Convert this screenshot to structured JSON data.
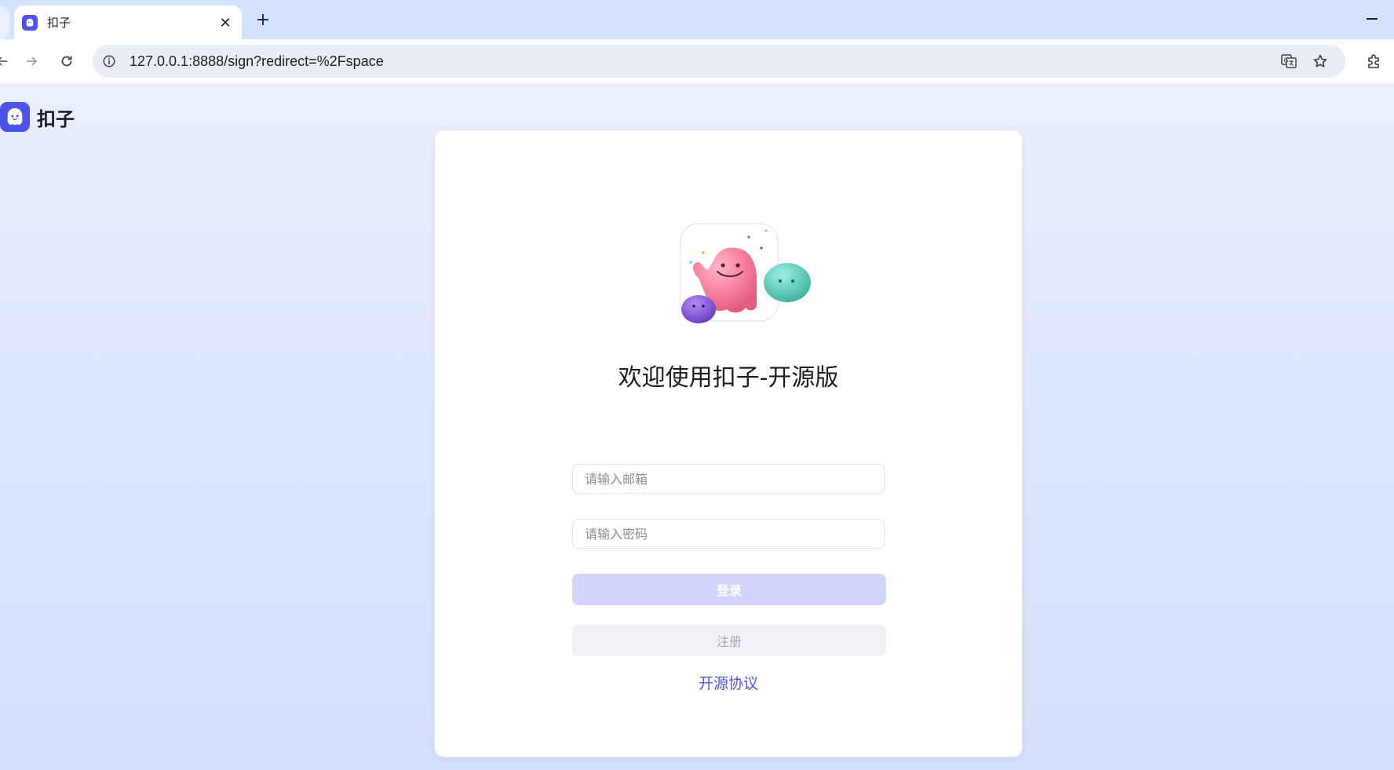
{
  "browser": {
    "tab": {
      "title": "扣子",
      "close_glyph": "✕"
    },
    "new_tab_glyph": "+",
    "url": "127.0.0.1:8888/sign?redirect=%2Fspace",
    "icons": [
      "back-icon",
      "forward-icon",
      "reload-icon",
      "site-info-icon",
      "translate-icon",
      "bookmark-star-icon",
      "extensions-icon",
      "minimize-icon"
    ]
  },
  "brand": {
    "name": "扣子",
    "color": "#4d53e8"
  },
  "login": {
    "title": "欢迎使用扣子-开源版",
    "email_placeholder": "请输入邮箱",
    "password_placeholder": "请输入密码",
    "login_label": "登录",
    "register_label": "注册",
    "license_link": "开源协议"
  },
  "colors": {
    "accent": "#4d53e8",
    "login_button_disabled": "#d2d4fb",
    "register_button": "#f1f2f5"
  }
}
